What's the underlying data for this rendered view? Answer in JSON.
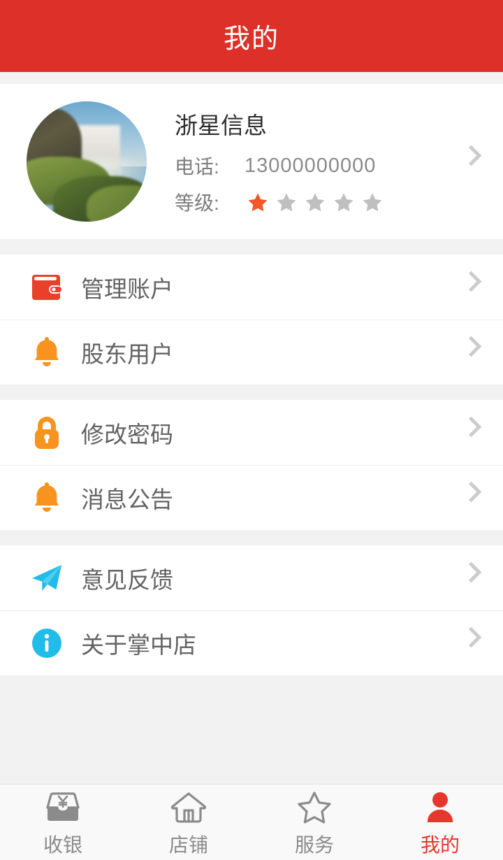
{
  "header": {
    "title": "我的"
  },
  "colors": {
    "brand_red": "#dd3029",
    "accent_red": "#e8402a",
    "orange": "#f7931e",
    "cyan": "#22bce8",
    "star_on": "#f2572a",
    "star_off": "#bfbfbf",
    "nav_active": "#e5372b",
    "nav_inactive": "#8b8b8b",
    "page_bg": "#f2f2f2"
  },
  "profile": {
    "avatar_icon": "waterfall-photo-avatar",
    "name": "浙星信息",
    "phone_label": "电话:",
    "phone_value": "13000000000",
    "level_label": "等级:",
    "level_rating": 1,
    "level_max": 5,
    "chevron_icon": "chevron-right-icon"
  },
  "groups": [
    {
      "id": "account-group",
      "rows": [
        {
          "id": "manage-account",
          "icon": "wallet-icon",
          "label": "管理账户",
          "chevron": "chevron-right-icon"
        },
        {
          "id": "shareholder-user",
          "icon": "bell-icon",
          "label": "股东用户",
          "chevron": "chevron-right-icon"
        }
      ]
    },
    {
      "id": "security-group",
      "rows": [
        {
          "id": "change-password",
          "icon": "lock-icon",
          "label": "修改密码",
          "chevron": "chevron-right-icon"
        },
        {
          "id": "message-notice",
          "icon": "bell-icon",
          "label": "消息公告",
          "chevron": "chevron-right-icon"
        }
      ]
    },
    {
      "id": "info-group",
      "rows": [
        {
          "id": "feedback",
          "icon": "paper-plane-icon",
          "label": "意见反馈",
          "chevron": "chevron-right-icon"
        },
        {
          "id": "about-app",
          "icon": "info-circle-icon",
          "label": "关于掌中店",
          "chevron": "chevron-right-icon"
        }
      ]
    }
  ],
  "bottom_nav": {
    "items": [
      {
        "id": "cashier",
        "icon": "cashier-tray-yen-icon",
        "label": "收银",
        "active": false
      },
      {
        "id": "shop",
        "icon": "home-icon",
        "label": "店铺",
        "active": false
      },
      {
        "id": "service",
        "icon": "star-outline-icon",
        "label": "服务",
        "active": false
      },
      {
        "id": "mine",
        "icon": "person-icon",
        "label": "我的",
        "active": true
      }
    ]
  }
}
